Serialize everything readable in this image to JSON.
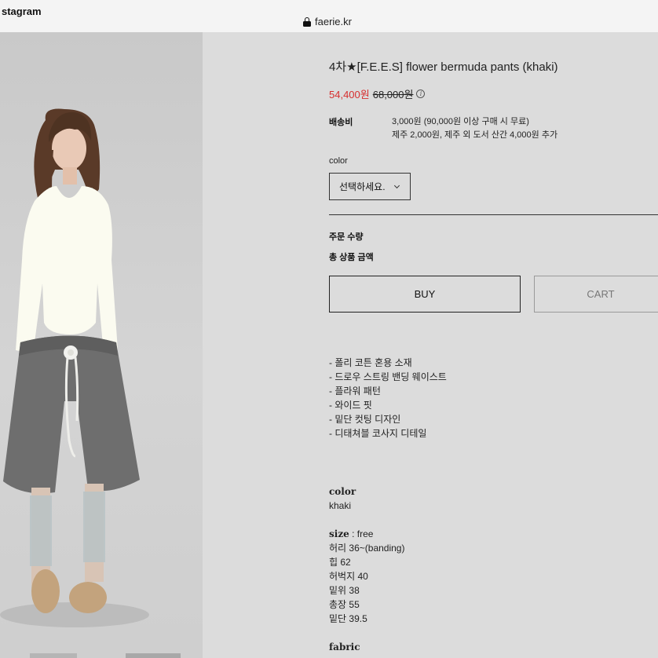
{
  "topbar": {
    "left_text": "stagram",
    "url": "faerie.kr"
  },
  "product": {
    "title": "4차★[F.E.E.S] flower bermuda pants (khaki)",
    "sale_price": "54,400원",
    "original_price": "68,000원",
    "shipping_label": "배송비",
    "shipping_lines": [
      "3,000원 (90,000원 이상 구매 시 무료)",
      "제주 2,000원, 제주 외 도서 산간 4,000원 추가"
    ],
    "color_label": "color",
    "select_placeholder": "선택하세요.",
    "qty_label": "주문 수량",
    "total_label": "총 상품 금액",
    "buy_label": "BUY",
    "cart_label": "CART"
  },
  "features": [
    "- 폴리 코튼 혼용 소재",
    "- 드로우 스트링 밴딩 웨이스트",
    "- 플라워 패턴",
    "- 와이드 핏",
    "- 밑단 컷팅 디자인",
    "- 디태쳐블 코사지 디테일"
  ],
  "spec": {
    "color_head": "color",
    "color_value": "khaki",
    "size_head": "size",
    "size_value": " : free",
    "measurements": [
      "허리 36~(banding)",
      "힙 62",
      "허벅지 40",
      "밑위 38",
      "총장 55",
      "밑단 39.5"
    ],
    "fabric_head": "fabric"
  },
  "colors": {
    "sale": "#d62f2f",
    "background": "#dcdcdc",
    "top": "#fbfbf0",
    "camisole": "#9fd6d0",
    "shorts": "#6e6e6e",
    "shoes": "#c3a37d"
  }
}
